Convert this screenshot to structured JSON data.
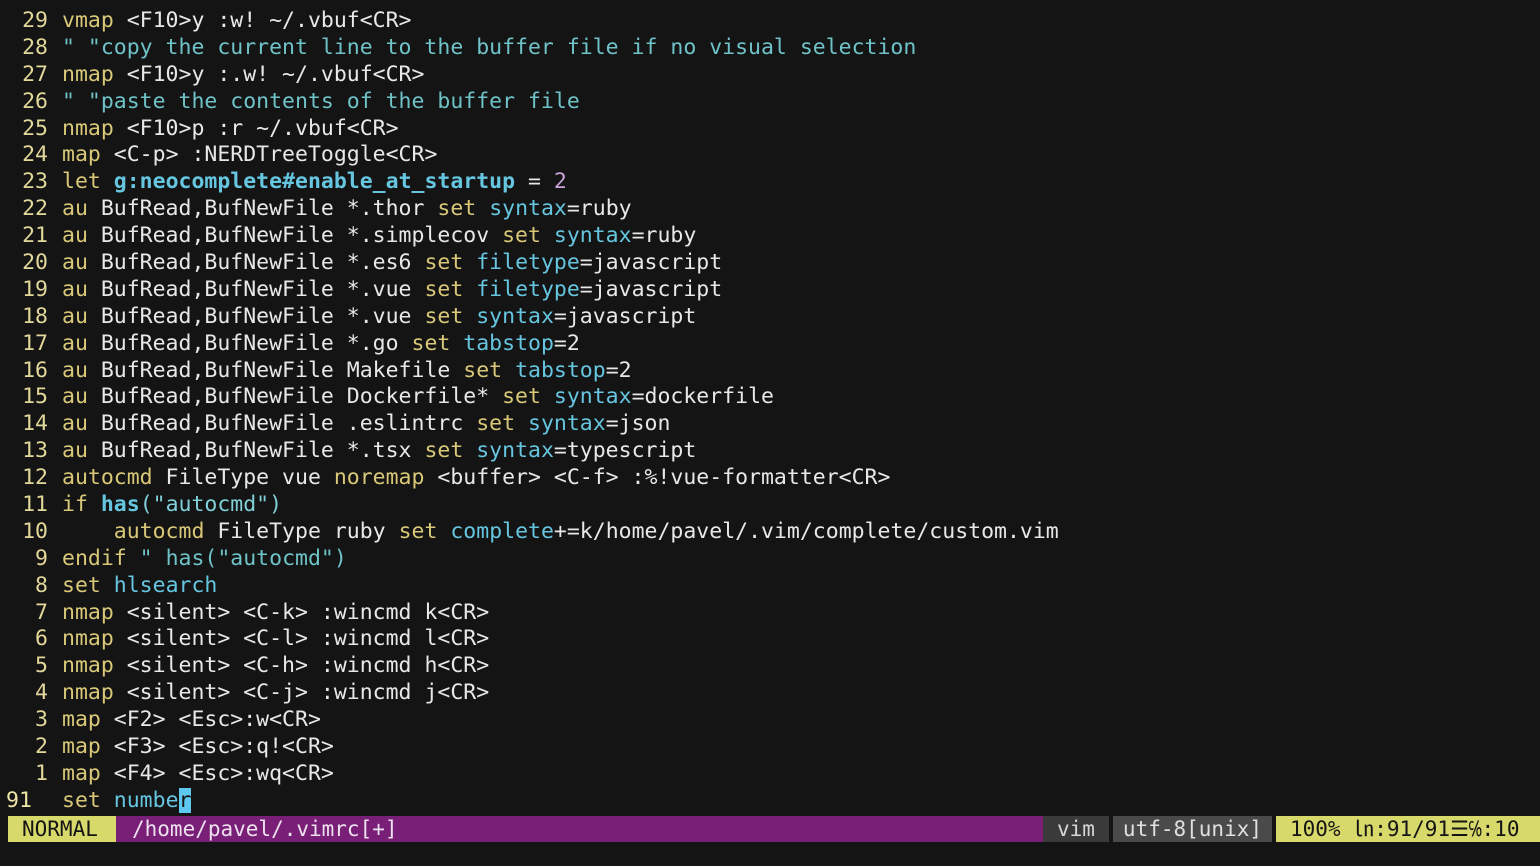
{
  "editor": {
    "lines": [
      {
        "n": "29",
        "segs": [
          [
            "kw",
            "vmap"
          ],
          [
            "plain",
            " <F10>y :w! ~/.vbuf<CR>"
          ]
        ]
      },
      {
        "n": "28",
        "segs": [
          [
            "cmt",
            "\" \"copy the current line to the buffer file if no visual selection"
          ]
        ]
      },
      {
        "n": "27",
        "segs": [
          [
            "kw",
            "nmap"
          ],
          [
            "plain",
            " <F10>y :.w! ~/.vbuf<CR>"
          ]
        ]
      },
      {
        "n": "26",
        "segs": [
          [
            "cmt",
            "\" \"paste the contents of the buffer file"
          ]
        ]
      },
      {
        "n": "25",
        "segs": [
          [
            "kw",
            "nmap"
          ],
          [
            "plain",
            " <F10>p :r ~/.vbuf<CR>"
          ]
        ]
      },
      {
        "n": "24",
        "segs": [
          [
            "kw",
            "map"
          ],
          [
            "plain",
            " <C-p> :NERDTreeToggle<CR>"
          ]
        ]
      },
      {
        "n": "23",
        "segs": [
          [
            "kw",
            "let"
          ],
          [
            "plain",
            " "
          ],
          [
            "var",
            "g:neocomplete#enable_at_startup"
          ],
          [
            "plain",
            " = "
          ],
          [
            "num",
            "2"
          ]
        ]
      },
      {
        "n": "22",
        "segs": [
          [
            "kw",
            "au"
          ],
          [
            "plain",
            " BufRead,BufNewFile *.thor "
          ],
          [
            "kw",
            "set"
          ],
          [
            "plain",
            " "
          ],
          [
            "opt",
            "syntax"
          ],
          [
            "plain",
            "=ruby"
          ]
        ]
      },
      {
        "n": "21",
        "segs": [
          [
            "kw",
            "au"
          ],
          [
            "plain",
            " BufRead,BufNewFile *.simplecov "
          ],
          [
            "kw",
            "set"
          ],
          [
            "plain",
            " "
          ],
          [
            "opt",
            "syntax"
          ],
          [
            "plain",
            "=ruby"
          ]
        ]
      },
      {
        "n": "20",
        "segs": [
          [
            "kw",
            "au"
          ],
          [
            "plain",
            " BufRead,BufNewFile *.es6 "
          ],
          [
            "kw",
            "set"
          ],
          [
            "plain",
            " "
          ],
          [
            "opt",
            "filetype"
          ],
          [
            "plain",
            "=javascript"
          ]
        ]
      },
      {
        "n": "19",
        "segs": [
          [
            "kw",
            "au"
          ],
          [
            "plain",
            " BufRead,BufNewFile *.vue "
          ],
          [
            "kw",
            "set"
          ],
          [
            "plain",
            " "
          ],
          [
            "opt",
            "filetype"
          ],
          [
            "plain",
            "=javascript"
          ]
        ]
      },
      {
        "n": "18",
        "segs": [
          [
            "kw",
            "au"
          ],
          [
            "plain",
            " BufRead,BufNewFile *.vue "
          ],
          [
            "kw",
            "set"
          ],
          [
            "plain",
            " "
          ],
          [
            "opt",
            "syntax"
          ],
          [
            "plain",
            "=javascript"
          ]
        ]
      },
      {
        "n": "17",
        "segs": [
          [
            "kw",
            "au"
          ],
          [
            "plain",
            " BufRead,BufNewFile *.go "
          ],
          [
            "kw",
            "set"
          ],
          [
            "plain",
            " "
          ],
          [
            "opt",
            "tabstop"
          ],
          [
            "plain",
            "=2"
          ]
        ]
      },
      {
        "n": "16",
        "segs": [
          [
            "kw",
            "au"
          ],
          [
            "plain",
            " BufRead,BufNewFile Makefile "
          ],
          [
            "kw",
            "set"
          ],
          [
            "plain",
            " "
          ],
          [
            "opt",
            "tabstop"
          ],
          [
            "plain",
            "=2"
          ]
        ]
      },
      {
        "n": "15",
        "segs": [
          [
            "kw",
            "au"
          ],
          [
            "plain",
            " BufRead,BufNewFile Dockerfile* "
          ],
          [
            "kw",
            "set"
          ],
          [
            "plain",
            " "
          ],
          [
            "opt",
            "syntax"
          ],
          [
            "plain",
            "=dockerfile"
          ]
        ]
      },
      {
        "n": "14",
        "segs": [
          [
            "kw",
            "au"
          ],
          [
            "plain",
            " BufRead,BufNewFile .eslintrc "
          ],
          [
            "kw",
            "set"
          ],
          [
            "plain",
            " "
          ],
          [
            "opt",
            "syntax"
          ],
          [
            "plain",
            "=json"
          ]
        ]
      },
      {
        "n": "13",
        "segs": [
          [
            "kw",
            "au"
          ],
          [
            "plain",
            " BufRead,BufNewFile *.tsx "
          ],
          [
            "kw",
            "set"
          ],
          [
            "plain",
            " "
          ],
          [
            "opt",
            "syntax"
          ],
          [
            "plain",
            "=typescript"
          ]
        ]
      },
      {
        "n": "12",
        "segs": [
          [
            "kw",
            "autocmd"
          ],
          [
            "plain",
            " FileType vue "
          ],
          [
            "kw",
            "noremap"
          ],
          [
            "plain",
            " <buffer> <C-f> :%!vue-formatter<CR>"
          ]
        ]
      },
      {
        "n": "11",
        "segs": [
          [
            "kw",
            "if"
          ],
          [
            "plain",
            " "
          ],
          [
            "fn",
            "has"
          ],
          [
            "str",
            "(\"autocmd\")"
          ]
        ]
      },
      {
        "n": "10",
        "segs": [
          [
            "plain",
            "    "
          ],
          [
            "kw",
            "autocmd"
          ],
          [
            "plain",
            " FileType ruby "
          ],
          [
            "kw",
            "set"
          ],
          [
            "plain",
            " "
          ],
          [
            "opt",
            "complete"
          ],
          [
            "plain",
            "+=k/home/pavel/.vim/complete/custom.vim"
          ]
        ]
      },
      {
        "n": "9",
        "segs": [
          [
            "kw",
            "endif"
          ],
          [
            "cmt",
            " \" has(\"autocmd\")"
          ]
        ]
      },
      {
        "n": "8",
        "segs": [
          [
            "kw",
            "set"
          ],
          [
            "plain",
            " "
          ],
          [
            "opt",
            "hlsearch"
          ]
        ]
      },
      {
        "n": "7",
        "segs": [
          [
            "kw",
            "nmap"
          ],
          [
            "plain",
            " <silent> <C-k> :wincmd k<CR>"
          ]
        ]
      },
      {
        "n": "6",
        "segs": [
          [
            "kw",
            "nmap"
          ],
          [
            "plain",
            " <silent> <C-l> :wincmd l<CR>"
          ]
        ]
      },
      {
        "n": "5",
        "segs": [
          [
            "kw",
            "nmap"
          ],
          [
            "plain",
            " <silent> <C-h> :wincmd h<CR>"
          ]
        ]
      },
      {
        "n": "4",
        "segs": [
          [
            "kw",
            "nmap"
          ],
          [
            "plain",
            " <silent> <C-j> :wincmd j<CR>"
          ]
        ]
      },
      {
        "n": "3",
        "segs": [
          [
            "kw",
            "map"
          ],
          [
            "plain",
            " <F2> <Esc>:w<CR>"
          ]
        ]
      },
      {
        "n": "2",
        "segs": [
          [
            "kw",
            "map"
          ],
          [
            "plain",
            " <F3> <Esc>:q!<CR>"
          ]
        ]
      },
      {
        "n": "1",
        "segs": [
          [
            "kw",
            "map"
          ],
          [
            "plain",
            " <F4> <Esc>:wq<CR>"
          ]
        ]
      },
      {
        "n": "91",
        "current": true,
        "segs": [
          [
            "kw",
            "set"
          ],
          [
            "plain",
            " "
          ],
          [
            "opt",
            "numbe"
          ],
          [
            "cursor",
            "r"
          ]
        ]
      }
    ]
  },
  "statusline": {
    "mode": "NORMAL",
    "file": "/home/pavel/.vimrc[+]",
    "filetype": "vim",
    "encoding": "utf-8[unix]",
    "position": "100% ㏑:91/91☰℅:10"
  },
  "colors": {
    "background": "#141414",
    "mode_bg": "#d7d96a",
    "file_bg": "#7a1f78",
    "cursor": "#5ec8f0"
  }
}
